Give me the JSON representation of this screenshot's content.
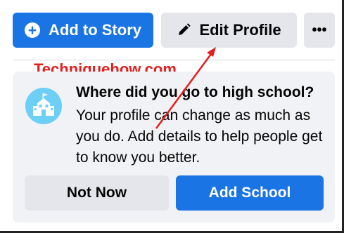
{
  "toolbar": {
    "add_story_label": "Add to Story",
    "edit_profile_label": "Edit Profile",
    "more_label": "•••"
  },
  "watermark": {
    "text": "Techniquehow.com"
  },
  "prompt_card": {
    "question": "Where did you go to high school?",
    "description": "Your profile can change as much as you do. Add details to help people get to know you better.",
    "not_now_label": "Not Now",
    "add_school_label": "Add School",
    "icon": "school-icon"
  },
  "colors": {
    "primary": "#1b74e4",
    "secondary_bg": "#e4e6eb",
    "card_bg": "#f0f2f5",
    "icon_bg": "#6ecff6",
    "annotation": "#e41e1e"
  }
}
